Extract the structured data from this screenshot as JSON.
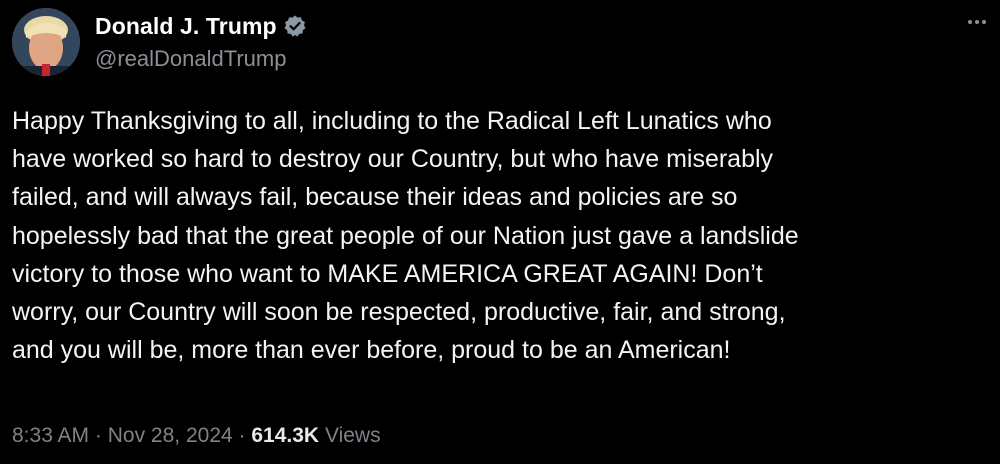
{
  "author": {
    "display_name": "Donald J. Trump",
    "handle": "@realDonaldTrump",
    "verified": true,
    "verified_color": "#8b98a5"
  },
  "tweet": {
    "lines": [
      "Happy Thanksgiving to all, including to the Radical Left Lunatics who",
      "have worked so hard to destroy our Country, but who have miserably",
      "failed, and will always fail, because their ideas and policies are so",
      "hopelessly bad that the great people of our Nation just gave a landslide",
      "victory to those who want to MAKE AMERICA GREAT AGAIN! Don’t",
      "worry, our Country will soon be respected, productive, fair, and strong,",
      "and you will be, more than ever before, proud to be an American!"
    ]
  },
  "meta": {
    "time": "8:33 AM",
    "separator": "·",
    "date": "Nov 28, 2024",
    "views_count": "614.3K",
    "views_label": "Views"
  },
  "icons": {
    "more": "more-horizontal-icon",
    "verified": "verified-badge-icon"
  }
}
